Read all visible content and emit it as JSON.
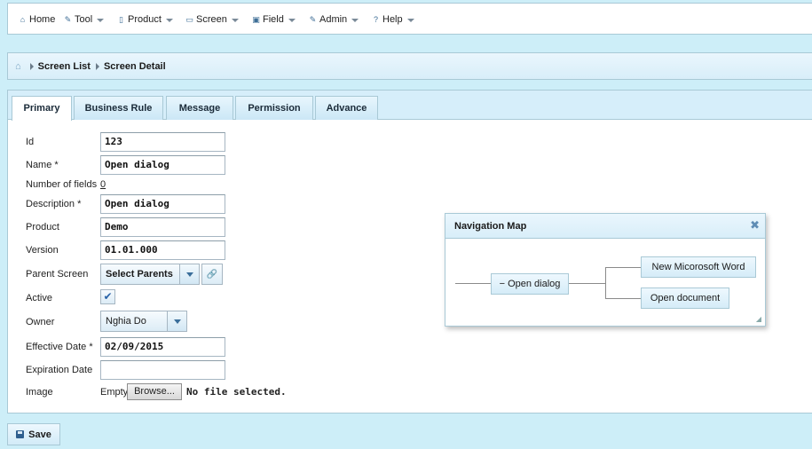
{
  "menu": [
    {
      "label": "Home",
      "icon": "home-icon",
      "glyph": "⌂",
      "dropdown": false
    },
    {
      "label": "Tool",
      "icon": "wrench-icon",
      "glyph": "✎",
      "dropdown": true
    },
    {
      "label": "Product",
      "icon": "document-icon",
      "glyph": "▯",
      "dropdown": true
    },
    {
      "label": "Screen",
      "icon": "screen-icon",
      "glyph": "▭",
      "dropdown": true
    },
    {
      "label": "Field",
      "icon": "field-icon",
      "glyph": "▣",
      "dropdown": true
    },
    {
      "label": "Admin",
      "icon": "pencil-icon",
      "glyph": "✎",
      "dropdown": true
    },
    {
      "label": "Help",
      "icon": "help-icon",
      "glyph": "?",
      "dropdown": true
    }
  ],
  "breadcrumb": {
    "home_icon": "⌂",
    "items": [
      "Screen List",
      "Screen Detail"
    ]
  },
  "tabs": [
    "Primary",
    "Business Rule",
    "Message",
    "Permission",
    "Advance"
  ],
  "active_tab": "Primary",
  "form": {
    "id": {
      "label": "Id",
      "value": "123"
    },
    "name": {
      "label": "Name *",
      "value": "Open dialog"
    },
    "number_of_fields": {
      "label": "Number of fields",
      "value": "0"
    },
    "description": {
      "label": "Description *",
      "value": "Open dialog"
    },
    "product": {
      "label": "Product",
      "value": "Demo"
    },
    "version": {
      "label": "Version",
      "value": "01.01.000"
    },
    "parent_screen": {
      "label": "Parent Screen",
      "value": "Select Parents",
      "link_icon": "🔗"
    },
    "active": {
      "label": "Active",
      "checked": true,
      "check_glyph": "✔"
    },
    "owner": {
      "label": "Owner",
      "value": "Nghia Do"
    },
    "effective_date": {
      "label": "Effective Date *",
      "value": "02/09/2015"
    },
    "expiration_date": {
      "label": "Expiration Date",
      "value": ""
    },
    "image": {
      "label": "Image",
      "empty_text": "Empty",
      "browse_label": "Browse...",
      "file_status": "No file selected."
    }
  },
  "navigation_map": {
    "title": "Navigation Map",
    "close_glyph": "✖",
    "root": {
      "label": "Open dialog",
      "collapse_glyph": "−"
    },
    "children": [
      "New Micorosoft Word",
      "Open document"
    ],
    "resize_glyph": "◢"
  },
  "save_label": "Save",
  "colors": {
    "background": "#cdeef8",
    "panel_border": "#a9c9d6",
    "accent": "#3a6e9a"
  }
}
